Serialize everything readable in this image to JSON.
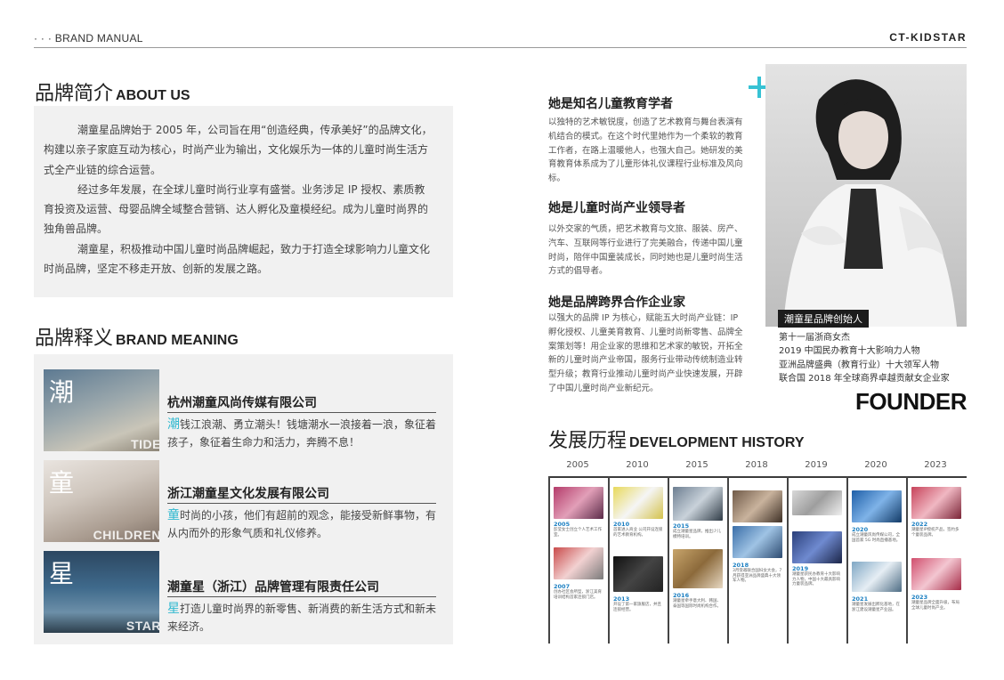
{
  "header": {
    "manual": "· · · BRAND MANUAL",
    "brand": "CT-KIDSTAR"
  },
  "about": {
    "title_zh": "品牌简介",
    "title_en": "ABOUT US",
    "paragraphs": [
      "潮童星品牌始于 2005 年，公司旨在用“创造经典，传承美好”的品牌文化，构建以亲子家庭互动为核心，时尚产业为输出，文化娱乐为一体的儿童时尚生活方式全产业链的综合运营。",
      "经过多年发展，在全球儿童时尚行业享有盛誉。业务涉足 IP 授权、素质教育投资及运营、母婴品牌全域整合营销、达人孵化及童模经纪。成为儿童时尚界的独角兽品牌。",
      "潮童星，积极推动中国儿童时尚品牌崛起，致力于打造全球影响力儿童文化时尚品牌，坚定不移走开放、创新的发展之路。"
    ]
  },
  "meaning": {
    "title_zh": "品牌释义",
    "title_en": "BRAND MEANING",
    "items": [
      {
        "char": "潮",
        "word": "TIDE",
        "company": "杭州潮童风尚传媒有限公司",
        "lead": "潮",
        "desc": "钱江浪潮、勇立潮头！钱塘潮水一浪接着一浪，象征着孩子，象征着生命力和活力，奔腾不息！"
      },
      {
        "char": "童",
        "word": "CHILDREN",
        "company": "浙江潮童星文化发展有限公司",
        "lead": "童",
        "desc": "时尚的小孩，他们有超前的观念，能接受新鲜事物，有从内而外的形象气质和礼仪修养。"
      },
      {
        "char": "星",
        "word": "STAR",
        "company": "潮童星（浙江）品牌管理有限责任公司",
        "lead": "星",
        "desc": "打造儿童时尚界的新零售、新消费的新生活方式和新未来经济。"
      }
    ]
  },
  "roles": [
    {
      "heading": "她是知名儿童教育学者",
      "text": "以独特的艺术敏锐度，创造了艺术教育与舞台表演有机结合的模式。在这个时代里她作为一个柔软的教育工作者，在路上温暖他人，也强大自己。她研发的美育教育体系成为了儿童形体礼仪课程行业标准及风向标。"
    },
    {
      "heading": "她是儿童时尚产业领导者",
      "text": "以外交家的气质，把艺术教育与文旅、服装、房产、汽车、互联网等行业进行了完美融合，传递中国儿童时尚，陪伴中国童装成长，同时她也是儿童时尚生活方式的倡导者。"
    },
    {
      "heading": "她是品牌跨界合作企业家",
      "text": "以强大的品牌 IP 为核心，赋能五大时尚产业链：IP 孵化授权、儿童美育教育、儿童时尚新零售、品牌全案策划等！用企业家的思维和艺术家的敏锐，开拓全新的儿童时尚产业帝国，服务行业带动传统制造业转型升级；教育行业推动儿童时尚产业快速发展，开辟了中国儿童时尚产业新纪元。"
    }
  ],
  "founder": {
    "caption": "潮童星品牌创始人",
    "honors": [
      "第十一届浙商女杰",
      "2019 中国民办教育十大影响力人物",
      "亚洲品牌盛典（教育行业）十大领军人物",
      "联合国 2018 年全球商界卓越贡献女企业家"
    ],
    "label": "FOUNDER"
  },
  "history": {
    "title_zh": "发展历程",
    "title_en": "DEVELOPMENT HISTORY",
    "years": [
      "2005",
      "2010",
      "2015",
      "2018",
      "2019",
      "2020",
      "2023"
    ],
    "entries": [
      {
        "col": 0,
        "year": "2005",
        "text": "彭莹女士创立个人艺术工作室。"
      },
      {
        "col": 0,
        "year": "2007",
        "text": "创办社区会所型，浙江美育培训结构首家连锁门店。"
      },
      {
        "col": 1,
        "year": "2010",
        "text": "首家进入商业 公司开设连锁的艺术教育机构。"
      },
      {
        "col": 1,
        "year": "2013",
        "text": "开设了第一家旗舰店，并且连锁经营。"
      },
      {
        "col": 2,
        "year": "2015",
        "text": "成立潮童星品牌，推出少儿模特培训。"
      },
      {
        "col": 2,
        "year": "2016",
        "text": "潮童星牵手意大利、韩国、泰国等国际时尚机构合作。"
      },
      {
        "col": 3,
        "year": "2018",
        "text": "3月受邀联合国妇女大会，7月获得亚洲品牌盛典十大领军人物。"
      },
      {
        "col": 4,
        "year": "2019",
        "text": "潮童星获民办教育十大影响力人物，中国十大最具影响力童装品牌。"
      },
      {
        "col": 5,
        "year": "2020",
        "text": "成立潮童风尚传媒公司，全国首家 5G 时尚直播基地。"
      },
      {
        "col": 5,
        "year": "2021",
        "text": "潮童星发展出孵化基地，在浙江建设潮童星产业园。"
      },
      {
        "col": 6,
        "year": "2022",
        "text": "潮童星IP授权产品，签约多个童装品牌。"
      },
      {
        "col": 6,
        "year": "2023",
        "text": "潮童星品牌全面升级，布局全球儿童时尚产业。"
      }
    ]
  },
  "colors": {
    "accent": "#37c2d4",
    "timeline_year": "#1b7fc2",
    "panel": "#f1f1f1"
  }
}
